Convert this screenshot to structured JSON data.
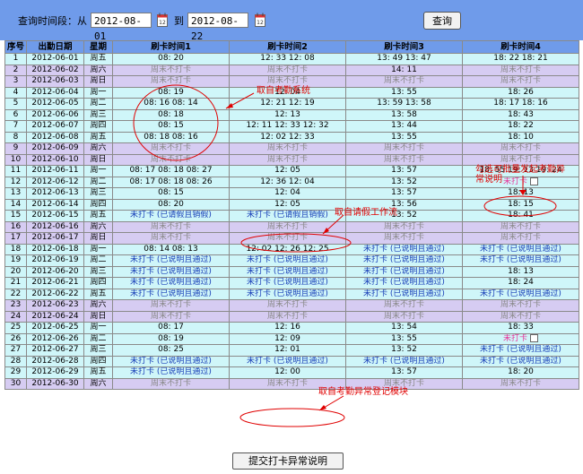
{
  "query": {
    "label": "查询时间段：从",
    "from_date": "2012-08-01",
    "to_label": "到",
    "to_date": "2012-08-22",
    "query_button": "查询"
  },
  "table": {
    "headers": [
      "序号",
      "出勤日期",
      "星期",
      "刷卡时间1",
      "刷卡时间2",
      "刷卡时间3",
      "刷卡时间4"
    ],
    "rows": [
      {
        "no": "1",
        "date": "2012-06-01",
        "week": "周五",
        "t1": "08: 20",
        "t2": "12: 33 12: 08",
        "t3": "13: 49 13: 47",
        "t4": "18: 22 18: 21",
        "type": "wd"
      },
      {
        "no": "2",
        "date": "2012-06-02",
        "week": "周六",
        "t1": "周末不打卡",
        "t2": "周末不打卡",
        "t3": "14: 11",
        "t4": "周末不打卡",
        "type": "we"
      },
      {
        "no": "3",
        "date": "2012-06-03",
        "week": "周日",
        "t1": "周末不打卡",
        "t2": "周末不打卡",
        "t3": "周末不打卡",
        "t4": "周末不打卡",
        "type": "we"
      },
      {
        "no": "4",
        "date": "2012-06-04",
        "week": "周一",
        "t1": "08: 19",
        "t2": "12: 04",
        "t3": "13: 55",
        "t4": "18: 26",
        "type": "wd"
      },
      {
        "no": "5",
        "date": "2012-06-05",
        "week": "周二",
        "t1": "08: 16 08: 14",
        "t2": "12: 21 12: 19",
        "t3": "13: 59 13: 58",
        "t4": "18: 17 18: 16",
        "type": "wd"
      },
      {
        "no": "6",
        "date": "2012-06-06",
        "week": "周三",
        "t1": "08: 18",
        "t2": "12: 13",
        "t3": "13: 58",
        "t4": "18: 43",
        "type": "wd"
      },
      {
        "no": "7",
        "date": "2012-06-07",
        "week": "周四",
        "t1": "08: 15",
        "t2": "12: 11 12: 33 12: 32",
        "t3": "13: 44",
        "t4": "18: 22",
        "type": "wd"
      },
      {
        "no": "8",
        "date": "2012-06-08",
        "week": "周五",
        "t1": "08: 18 08: 16",
        "t2": "12: 02 12: 33",
        "t3": "13: 55",
        "t4": "18: 10",
        "type": "wd"
      },
      {
        "no": "9",
        "date": "2012-06-09",
        "week": "周六",
        "t1": "周末不打卡",
        "t2": "周末不打卡",
        "t3": "周末不打卡",
        "t4": "周末不打卡",
        "type": "we"
      },
      {
        "no": "10",
        "date": "2012-06-10",
        "week": "周日",
        "t1": "周末不打卡",
        "t2": "周末不打卡",
        "t3": "周末不打卡",
        "t4": "周末不打卡",
        "type": "we"
      },
      {
        "no": "11",
        "date": "2012-06-11",
        "week": "周一",
        "t1": "08: 17 08: 18 08: 27",
        "t2": "12: 05",
        "t3": "13: 57",
        "t4": "18: 55 19: 13 19: 24",
        "type": "wd"
      },
      {
        "no": "12",
        "date": "2012-06-12",
        "week": "周二",
        "t1": "08: 17 08: 18 08: 26",
        "t2": "12: 36 12: 04",
        "t3": "13: 52",
        "t4": "未打卡",
        "t4_style": "misspink",
        "t4_checkbox": true,
        "type": "wd"
      },
      {
        "no": "13",
        "date": "2012-06-13",
        "week": "周三",
        "t1": "08: 15",
        "t2": "12: 04",
        "t3": "13: 57",
        "t4": "18: 13",
        "type": "wd"
      },
      {
        "no": "14",
        "date": "2012-06-14",
        "week": "周四",
        "t1": "08: 20",
        "t2": "12: 05",
        "t3": "13: 56",
        "t4": "18: 15",
        "type": "wd"
      },
      {
        "no": "15",
        "date": "2012-06-15",
        "week": "周五",
        "t1": "未打卡 (已请假且销假)",
        "t1_style": "miss",
        "t2": "未打卡 (已请假且销假)",
        "t2_style": "miss",
        "t3": "13: 52",
        "t4": "18: 41",
        "type": "wd"
      },
      {
        "no": "16",
        "date": "2012-06-16",
        "week": "周六",
        "t1": "周末不打卡",
        "t2": "周末不打卡",
        "t3": "周末不打卡",
        "t4": "周末不打卡",
        "type": "we"
      },
      {
        "no": "17",
        "date": "2012-06-17",
        "week": "周日",
        "t1": "周末不打卡",
        "t2": "周末不打卡",
        "t3": "周末不打卡",
        "t4": "周末不打卡",
        "type": "we"
      },
      {
        "no": "18",
        "date": "2012-06-18",
        "week": "周一",
        "t1": "08: 14 08: 13",
        "t2": "12: 02 12: 26 12: 25",
        "t3": "未打卡 (已说明且通过)",
        "t3_style": "miss",
        "t4": "未打卡 (已说明且通过)",
        "t4_style": "miss",
        "type": "wd"
      },
      {
        "no": "19",
        "date": "2012-06-19",
        "week": "周二",
        "t1": "未打卡 (已说明且通过)",
        "t1_style": "miss",
        "t2": "未打卡 (已说明且通过)",
        "t2_style": "miss",
        "t3": "未打卡 (已说明且通过)",
        "t3_style": "miss",
        "t4": "未打卡 (已说明且通过)",
        "t4_style": "miss",
        "type": "wd"
      },
      {
        "no": "20",
        "date": "2012-06-20",
        "week": "周三",
        "t1": "未打卡 (已说明且通过)",
        "t1_style": "miss",
        "t2": "未打卡 (已说明且通过)",
        "t2_style": "miss",
        "t3": "未打卡 (已说明且通过)",
        "t3_style": "miss",
        "t4": "18: 13",
        "type": "wd"
      },
      {
        "no": "21",
        "date": "2012-06-21",
        "week": "周四",
        "t1": "未打卡 (已说明且通过)",
        "t1_style": "miss",
        "t2": "未打卡 (已说明且通过)",
        "t2_style": "miss",
        "t3": "未打卡 (已说明且通过)",
        "t3_style": "miss",
        "t4": "18: 24",
        "type": "wd"
      },
      {
        "no": "22",
        "date": "2012-06-22",
        "week": "周五",
        "t1": "未打卡 (已说明且通过)",
        "t1_style": "miss",
        "t2": "未打卡 (已说明且通过)",
        "t2_style": "miss",
        "t3": "未打卡 (已说明且通过)",
        "t3_style": "miss",
        "t4": "未打卡 (已说明且通过)",
        "t4_style": "miss",
        "type": "wd"
      },
      {
        "no": "23",
        "date": "2012-06-23",
        "week": "周六",
        "t1": "周末不打卡",
        "t2": "周末不打卡",
        "t3": "周末不打卡",
        "t4": "周末不打卡",
        "type": "we"
      },
      {
        "no": "24",
        "date": "2012-06-24",
        "week": "周日",
        "t1": "周末不打卡",
        "t2": "周末不打卡",
        "t3": "周末不打卡",
        "t4": "周末不打卡",
        "type": "we"
      },
      {
        "no": "25",
        "date": "2012-06-25",
        "week": "周一",
        "t1": "08: 17",
        "t2": "12: 16",
        "t3": "13: 54",
        "t4": "18: 33",
        "type": "wd"
      },
      {
        "no": "26",
        "date": "2012-06-26",
        "week": "周二",
        "t1": "08: 19",
        "t2": "12: 09",
        "t3": "13: 55",
        "t4": "未打卡",
        "t4_style": "misspink",
        "t4_checkbox": true,
        "type": "wd"
      },
      {
        "no": "27",
        "date": "2012-06-27",
        "week": "周三",
        "t1": "08: 25",
        "t2": "12: 01",
        "t3": "13: 52",
        "t4": "未打卡 (已说明且通过)",
        "t4_style": "miss",
        "type": "wd"
      },
      {
        "no": "28",
        "date": "2012-06-28",
        "week": "周四",
        "t1": "未打卡 (已说明且通过)",
        "t1_style": "miss",
        "t2": "未打卡 (已说明且通过)",
        "t2_style": "miss",
        "t3": "未打卡 (已说明且通过)",
        "t3_style": "miss",
        "t4": "未打卡 (已说明且通过)",
        "t4_style": "miss",
        "type": "wd"
      },
      {
        "no": "29",
        "date": "2012-06-29",
        "week": "周五",
        "t1": "未打卡 (已说明且通过)",
        "t1_style": "miss",
        "t2": "12: 00",
        "t3": "13: 57",
        "t4": "18: 20",
        "type": "wd"
      },
      {
        "no": "30",
        "date": "2012-06-30",
        "week": "周六",
        "t1": "周末不打卡",
        "t2": "周末不打卡",
        "t3": "周末不打卡",
        "t4": "周末不打卡",
        "type": "we"
      }
    ]
  },
  "annotations": {
    "from_attendance_system": "取自考勤系统",
    "from_leave_flow": "取自请假工作流",
    "from_exception_module": "取自考勤异常登记模块",
    "batch_exception_line1": "勾选可批量发起考勤异",
    "batch_exception_line2": "常说明"
  },
  "submit_button": "提交打卡异常说明",
  "colors": {
    "header_blue": "#6f9bea",
    "weekday_row": "#cff6f9",
    "weekend_row": "#d6ccf2",
    "missed_text": "#1a40b8",
    "missed_pink": "#e6359a",
    "annotation_red": "#e00000"
  }
}
